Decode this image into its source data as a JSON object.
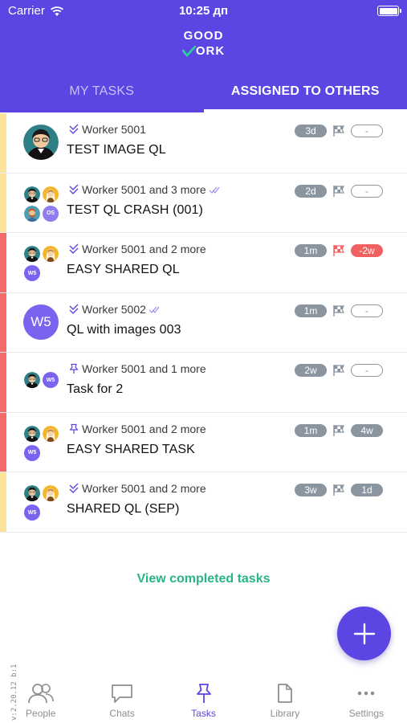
{
  "status_bar": {
    "carrier": "Carrier",
    "time": "10:25 дп"
  },
  "logo": {
    "line1": "GOOD",
    "line2": "ORK"
  },
  "tabs": [
    {
      "label": "MY TASKS",
      "active": false
    },
    {
      "label": "ASSIGNED TO OTHERS",
      "active": true
    }
  ],
  "colors": {
    "brand": "#5b45e3",
    "accent_green": "#2ab38a",
    "stripe_yellow": "#fbe49a",
    "stripe_red": "#f46a6a",
    "chip_grey": "#8a95a0",
    "chip_red": "#f06262"
  },
  "tasks": [
    {
      "meta": "Worker 5001",
      "title": "TEST IMAGE QL",
      "stripe": "#fbe49a",
      "chip1": "3d",
      "chip2": "-",
      "chip2_style": "outline",
      "flag_color": "#8a95a0",
      "seen": false,
      "type_icon": "double-check-icon"
    },
    {
      "meta": "Worker 5001 and 3 more",
      "title": "TEST QL CRASH (001)",
      "stripe": "#fbe49a",
      "chip1": "2d",
      "chip2": "-",
      "chip2_style": "outline",
      "flag_color": "#8a95a0",
      "seen": true,
      "type_icon": "double-check-icon"
    },
    {
      "meta": "Worker 5001 and 2 more",
      "title": "EASY SHARED QL",
      "stripe": "#f46a6a",
      "chip1": "1m",
      "chip2": "-2w",
      "chip2_style": "red",
      "flag_color": "#f06262",
      "seen": false,
      "type_icon": "double-check-icon"
    },
    {
      "meta": "Worker 5002",
      "title": "QL with images 003",
      "stripe": "#f46a6a",
      "chip1": "1m",
      "chip2": "-",
      "chip2_style": "outline",
      "flag_color": "#8a95a0",
      "seen": true,
      "type_icon": "double-check-icon",
      "avatar_initials": "W5"
    },
    {
      "meta": "Worker 5001 and 1 more",
      "title": "Task for 2",
      "stripe": "#f46a6a",
      "chip1": "2w",
      "chip2": "-",
      "chip2_style": "outline",
      "flag_color": "#8a95a0",
      "seen": false,
      "type_icon": "pin-icon"
    },
    {
      "meta": "Worker 5001 and 2 more",
      "title": "EASY SHARED TASK",
      "stripe": "#f46a6a",
      "chip1": "1m",
      "chip2": "4w",
      "chip2_style": "grey",
      "flag_color": "#8a95a0",
      "seen": false,
      "type_icon": "pin-icon"
    },
    {
      "meta": "Worker 5001 and 2 more",
      "title": "SHARED QL (SEP)",
      "stripe": "#fbe49a",
      "chip1": "3w",
      "chip2": "1d",
      "chip2_style": "grey",
      "flag_color": "#8a95a0",
      "seen": false,
      "type_icon": "double-check-icon"
    }
  ],
  "avatar_labels": {
    "worker_initials": "W5",
    "other_initials": "OS"
  },
  "view_completed": "View completed tasks",
  "version": "v:2.20.12 b:1",
  "bottom_nav": [
    {
      "label": "People",
      "icon": "people-icon",
      "active": false
    },
    {
      "label": "Chats",
      "icon": "chat-icon",
      "active": false
    },
    {
      "label": "Tasks",
      "icon": "pin-icon",
      "active": true
    },
    {
      "label": "Library",
      "icon": "document-icon",
      "active": false
    },
    {
      "label": "Settings",
      "icon": "more-icon",
      "active": false
    }
  ]
}
